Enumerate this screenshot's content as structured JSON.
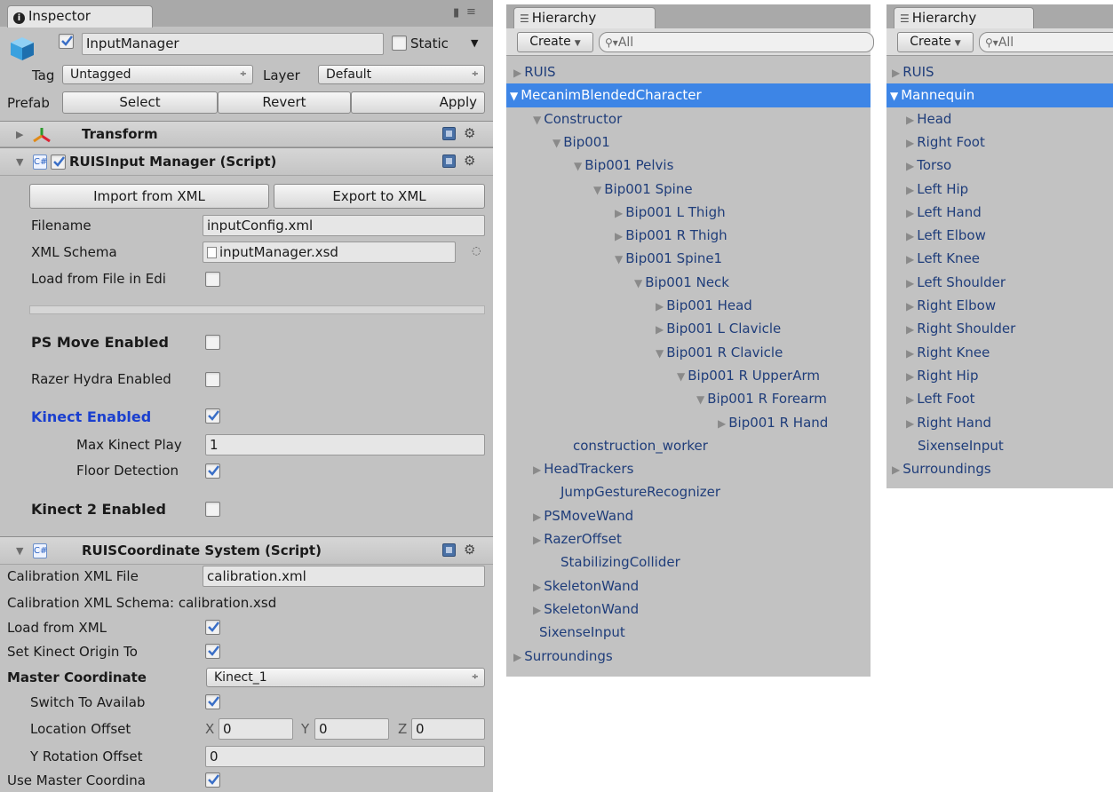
{
  "inspector": {
    "tab_label": "Inspector",
    "object_name": "InputManager",
    "static_label": "Static",
    "tag_label": "Tag",
    "tag_value": "Untagged",
    "layer_label": "Layer",
    "layer_value": "Default",
    "prefab_label": "Prefab",
    "select_label": "Select",
    "revert_label": "Revert",
    "apply_label": "Apply",
    "transform_label": "Transform",
    "input_manager": {
      "title": "RUISInput Manager (Script)",
      "import_label": "Import from XML",
      "export_label": "Export to XML",
      "filename_label": "Filename",
      "filename_value": "inputConfig.xml",
      "schema_label": "XML Schema",
      "schema_value": "inputManager.xsd",
      "load_label": "Load from File in Edi",
      "psmove_label": "PS Move Enabled",
      "razer_label": "Razer Hydra Enabled",
      "kinect_label": "Kinect Enabled",
      "max_players_label": "Max Kinect Play",
      "max_players_value": "1",
      "floor_label": "Floor Detection",
      "kinect2_label": "Kinect 2 Enabled"
    },
    "coordinate_system": {
      "title": "RUISCoordinate System (Script)",
      "calib_file_label": "Calibration XML File",
      "calib_file_value": "calibration.xml",
      "calib_schema_text": "Calibration XML Schema: calibration.xsd",
      "load_xml_label": "Load from XML",
      "set_origin_label": "Set Kinect Origin To",
      "master_label": "Master Coordinate",
      "master_value": "Kinect_1",
      "switch_label": "Switch To Availab",
      "location_label": "Location Offset",
      "x_label": "X",
      "x_value": "0",
      "y_label": "Y",
      "y_value": "0",
      "z_label": "Z",
      "z_value": "0",
      "yrot_label": "Y Rotation Offset",
      "yrot_value": "0",
      "use_master_label": "Use Master Coordina"
    }
  },
  "hierarchy1": {
    "tab_label": "Hierarchy",
    "create_label": "Create",
    "search_placeholder": "All",
    "rows": [
      {
        "label": "RUIS",
        "arrow": "▶"
      },
      {
        "label": "MecanimBlendedCharacter",
        "arrow": "▼"
      },
      {
        "label": "Constructor",
        "arrow": "▼"
      },
      {
        "label": "Bip001",
        "arrow": "▼"
      },
      {
        "label": "Bip001 Pelvis",
        "arrow": "▼"
      },
      {
        "label": "Bip001 Spine",
        "arrow": "▼"
      },
      {
        "label": "Bip001 L Thigh",
        "arrow": "▶"
      },
      {
        "label": "Bip001 R Thigh",
        "arrow": "▶"
      },
      {
        "label": "Bip001 Spine1",
        "arrow": "▼"
      },
      {
        "label": "Bip001 Neck",
        "arrow": "▼"
      },
      {
        "label": "Bip001 Head",
        "arrow": "▶"
      },
      {
        "label": "Bip001 L Clavicle",
        "arrow": "▶"
      },
      {
        "label": "Bip001 R Clavicle",
        "arrow": "▼"
      },
      {
        "label": "Bip001 R UpperArm",
        "arrow": "▼"
      },
      {
        "label": "Bip001 R Forearm",
        "arrow": "▼"
      },
      {
        "label": "Bip001 R Hand",
        "arrow": "▶"
      },
      {
        "label": "construction_worker",
        "arrow": ""
      },
      {
        "label": "HeadTrackers",
        "arrow": "▶"
      },
      {
        "label": "JumpGestureRecognizer",
        "arrow": ""
      },
      {
        "label": "PSMoveWand",
        "arrow": "▶"
      },
      {
        "label": "RazerOffset",
        "arrow": "▶"
      },
      {
        "label": "StabilizingCollider",
        "arrow": ""
      },
      {
        "label": "SkeletonWand",
        "arrow": "▶"
      },
      {
        "label": "SkeletonWand",
        "arrow": "▶"
      },
      {
        "label": "SixenseInput",
        "arrow": ""
      },
      {
        "label": "Surroundings",
        "arrow": "▶"
      }
    ]
  },
  "hierarchy2": {
    "tab_label": "Hierarchy",
    "create_label": "Create",
    "search_placeholder": "All",
    "rows": [
      {
        "label": "RUIS",
        "arrow": "▶"
      },
      {
        "label": "Mannequin",
        "arrow": "▼"
      },
      {
        "label": "Head",
        "arrow": "▶"
      },
      {
        "label": "Right Foot",
        "arrow": "▶"
      },
      {
        "label": "Torso",
        "arrow": "▶"
      },
      {
        "label": "Left Hip",
        "arrow": "▶"
      },
      {
        "label": "Left Hand",
        "arrow": "▶"
      },
      {
        "label": "Left Elbow",
        "arrow": "▶"
      },
      {
        "label": "Left Knee",
        "arrow": "▶"
      },
      {
        "label": "Left Shoulder",
        "arrow": "▶"
      },
      {
        "label": "Right Elbow",
        "arrow": "▶"
      },
      {
        "label": "Right Shoulder",
        "arrow": "▶"
      },
      {
        "label": "Right Knee",
        "arrow": "▶"
      },
      {
        "label": "Right Hip",
        "arrow": "▶"
      },
      {
        "label": "Left Foot",
        "arrow": "▶"
      },
      {
        "label": "Right Hand",
        "arrow": "▶"
      },
      {
        "label": "SixenseInput",
        "arrow": ""
      },
      {
        "label": "Surroundings",
        "arrow": "▶"
      }
    ]
  },
  "colors": {
    "selection": "#3d85e6",
    "panel": "#c2c2c2",
    "link_text": "#1f3d7a",
    "kinect_label": "#1a3fcf"
  }
}
